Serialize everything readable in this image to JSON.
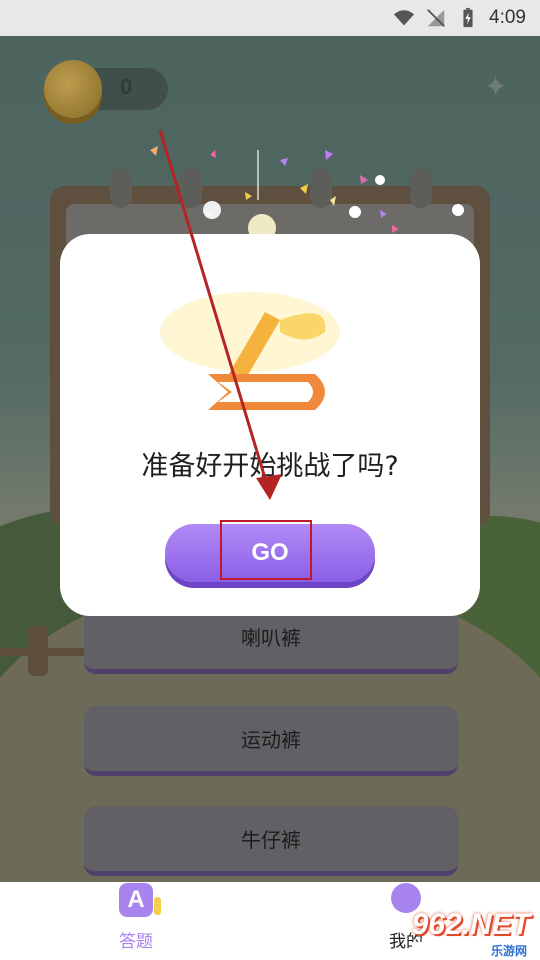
{
  "status_bar": {
    "time": "4:09"
  },
  "header": {
    "coin_count": "0"
  },
  "answers": [
    "喇叭裤",
    "运动裤",
    "牛仔裤"
  ],
  "dialog": {
    "question": "准备好开始挑战了吗?",
    "go_label": "GO"
  },
  "tabs": [
    {
      "label": "答题",
      "color": "#a884ee",
      "active": true
    },
    {
      "label": "我的",
      "color": "#222222",
      "active": false
    }
  ],
  "watermark": {
    "text": "962.NET",
    "sub": "乐游网"
  },
  "colors": {
    "accent": "#a884ee",
    "button": "#8a5fe6",
    "annotation": "#c01a2a"
  }
}
